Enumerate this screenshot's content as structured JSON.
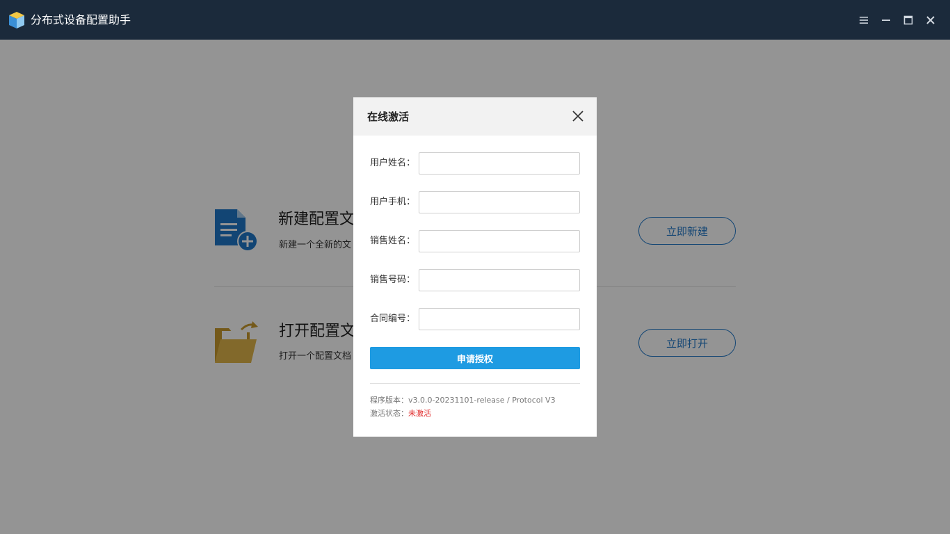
{
  "app": {
    "title": "分布式设备配置助手",
    "icon": "cube-app-icon"
  },
  "window_controls": [
    "menu-icon",
    "minimize-icon",
    "maximize-icon",
    "close-icon"
  ],
  "cards": [
    {
      "title": "新建配置文",
      "desc": "新建一个全新的文",
      "button": "立即新建",
      "icon": "new-document-icon",
      "icon_color": "#1f77c8"
    },
    {
      "title": "打开配置文",
      "desc": "打开一个配置文档",
      "button": "立即打开",
      "icon": "open-folder-icon",
      "icon_color": "#d8ad3a"
    }
  ],
  "dialog": {
    "title": "在线激活",
    "fields": [
      {
        "label": "用户姓名：",
        "value": "",
        "placeholder": ""
      },
      {
        "label": "用户手机：",
        "value": "",
        "placeholder": ""
      },
      {
        "label": "销售姓名：",
        "value": "",
        "placeholder": ""
      },
      {
        "label": "销售号码：",
        "value": "",
        "placeholder": ""
      },
      {
        "label": "合同编号：",
        "value": "",
        "placeholder": ""
      }
    ],
    "submit": "申请授权",
    "version_label": "程序版本：",
    "version_value": "v3.0.0-20231101-release / Protocol V3",
    "status_label": "激活状态：",
    "status_value": "未激活"
  },
  "colors": {
    "titlebar": "#1b2a3b",
    "accent": "#1f77c8",
    "submit": "#1e9be2",
    "status_error": "#e02828"
  }
}
